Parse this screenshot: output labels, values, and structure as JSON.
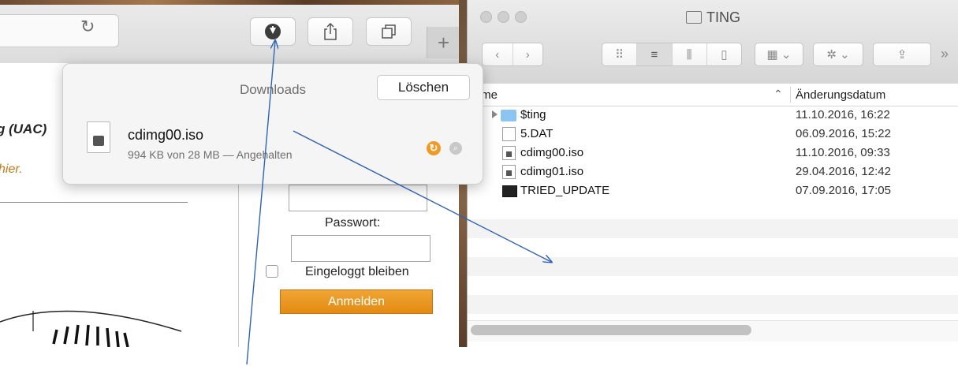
{
  "safari": {
    "toolbar": {
      "reload_icon": "reload-icon",
      "download_icon": "download-icon",
      "share_icon": "share-icon",
      "tabs_icon": "tabs-icon",
      "new_tab_label": "+"
    },
    "web": {
      "uac_text": "g (UAC)",
      "hier_text": "hier.",
      "password_label": "Passwort:",
      "stay_logged_in_label": "Eingeloggt bleiben",
      "login_button": "Anmelden"
    }
  },
  "downloads": {
    "title": "Downloads",
    "clear_button": "Löschen",
    "item": {
      "name": "cdimg00.iso",
      "status": "994 KB von 28 MB — Angehalten"
    }
  },
  "finder": {
    "title": "TING",
    "columns": {
      "name": "Name",
      "date": "Änderungsdatum"
    },
    "rows": [
      {
        "name": "$ting",
        "date": "11.10.2016, 16:22",
        "icon": "folder-icon"
      },
      {
        "name": "5.DAT",
        "date": "06.09.2016, 15:22",
        "icon": "document-icon"
      },
      {
        "name": "cdimg00.iso",
        "date": "11.10.2016, 09:33",
        "icon": "disk-image-icon"
      },
      {
        "name": "cdimg01.iso",
        "date": "29.04.2016, 12:42",
        "icon": "disk-image-icon"
      },
      {
        "name": "TRIED_UPDATE",
        "date": "07.09.2016, 17:05",
        "icon": "terminal-icon"
      }
    ]
  },
  "colors": {
    "accent_orange": "#e8951f",
    "annotation_arrow": "#2f63b4",
    "folder_blue": "#8cc5f2"
  }
}
